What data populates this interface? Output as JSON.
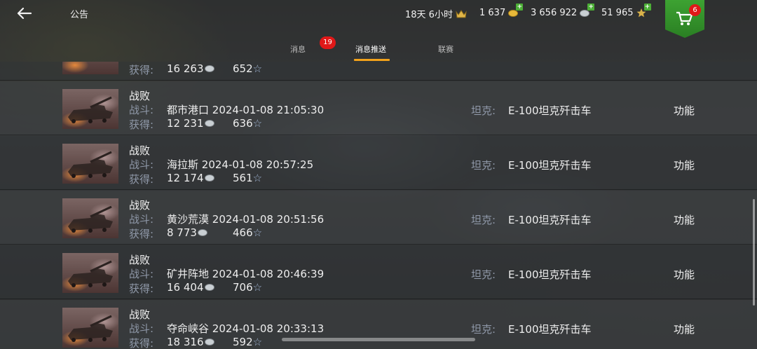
{
  "header": {
    "title": "公告",
    "timer": "18天 6小时",
    "gold": "1 637",
    "silver": "3 656 922",
    "free_xp": "51 965",
    "shop_badge": "6"
  },
  "tabs": [
    {
      "label": "消息",
      "badge": "19"
    },
    {
      "label": "消息推送"
    },
    {
      "label": "联赛"
    }
  ],
  "labels": {
    "battle": "战斗:",
    "earned": "获得:",
    "tank": "坦克:",
    "function": "功能"
  },
  "partial_row": {
    "credits": "16 263",
    "xp": "652"
  },
  "rows": [
    {
      "result": "战败",
      "map": "都市港口",
      "datetime": "2024-01-08 21:05:30",
      "credits": "12 231",
      "xp": "636",
      "tank": "E-100坦克歼击车"
    },
    {
      "result": "战败",
      "map": "海拉斯",
      "datetime": "2024-01-08 20:57:25",
      "credits": "12 174",
      "xp": "561",
      "tank": "E-100坦克歼击车"
    },
    {
      "result": "战败",
      "map": "黄沙荒漠",
      "datetime": "2024-01-08 20:51:56",
      "credits": "8 773",
      "xp": "466",
      "tank": "E-100坦克歼击车"
    },
    {
      "result": "战败",
      "map": "矿井阵地",
      "datetime": "2024-01-08 20:46:39",
      "credits": "16 404",
      "xp": "706",
      "tank": "E-100坦克歼击车"
    },
    {
      "result": "战败",
      "map": "夺命峡谷",
      "datetime": "2024-01-08 20:33:13",
      "credits": "18 316",
      "xp": "592",
      "tank": "E-100坦克歼击车"
    }
  ],
  "colors": {
    "accent": "#f2a21b",
    "badge": "#e01818",
    "shop": "#3da232",
    "label": "#8f98a8"
  }
}
